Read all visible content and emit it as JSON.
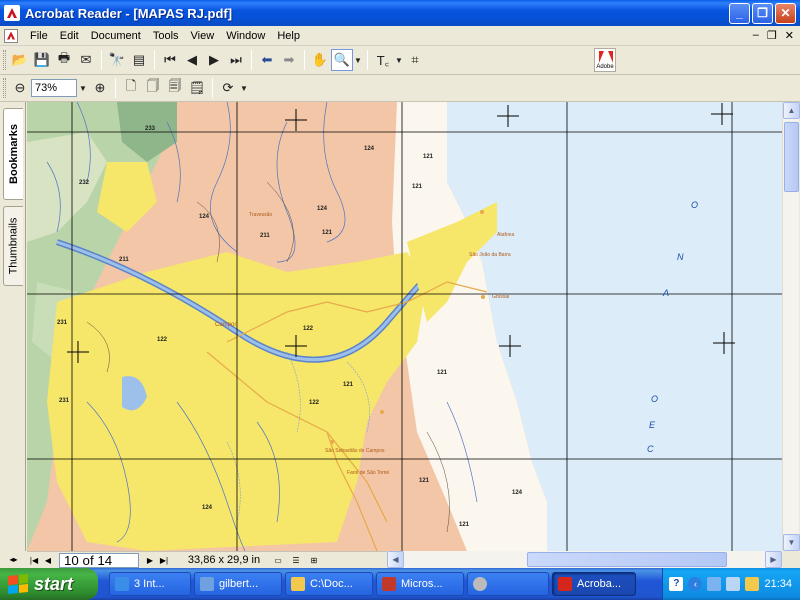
{
  "window": {
    "title": "Acrobat Reader - [MAPAS RJ.pdf]",
    "minimize": "_",
    "maximize": "❐",
    "close": "✕"
  },
  "menu": {
    "items": [
      "File",
      "Edit",
      "Document",
      "Tools",
      "View",
      "Window",
      "Help"
    ],
    "mdi_minimize": "–",
    "mdi_restore": "❐",
    "mdi_close": "✕"
  },
  "toolbar": {
    "zoom_value": "73%",
    "adobe_logo_text": "Adobe"
  },
  "side_tabs": {
    "bookmarks": "Bookmarks",
    "thumbnails": "Thumbnails"
  },
  "map": {
    "region_numbers": [
      "233",
      "232",
      "231",
      "231",
      "211",
      "211",
      "124",
      "124",
      "124",
      "121",
      "121",
      "121",
      "121",
      "122",
      "122",
      "122",
      "121",
      "121",
      "124",
      "124",
      "121"
    ],
    "places": [
      "Campos",
      "São João da Barra",
      "Grussai",
      "São Sebastião de Campos",
      "Farol de São Tomé",
      "Travessão",
      "Atafona"
    ],
    "ocean_letters": [
      "O",
      "C",
      "E",
      "A",
      "N",
      "O"
    ]
  },
  "status": {
    "page_display": "10 of 14",
    "page_size": "33,86 x 29,9 in"
  },
  "taskbar": {
    "start_label": "start",
    "buttons": [
      {
        "label": "3 Int...",
        "icon_color": "#3a8ee8"
      },
      {
        "label": "gilbert...",
        "icon_color": "#6fa1e0"
      },
      {
        "label": "C:\\Doc...",
        "icon_color": "#f2c94c"
      },
      {
        "label": "Micros...",
        "icon_color": "#c0392b"
      },
      {
        "label": "",
        "icon_color": "#bbbbbb"
      },
      {
        "label": "Acroba...",
        "icon_color": "#d4261c"
      }
    ],
    "clock": "21:34"
  },
  "colors": {
    "titlebar": "#0a4cc4",
    "map_yellow": "#f6e66a",
    "map_ocean": "#dcecf8",
    "map_salmon": "#f2c6a6",
    "map_green": "#a9c99a"
  }
}
